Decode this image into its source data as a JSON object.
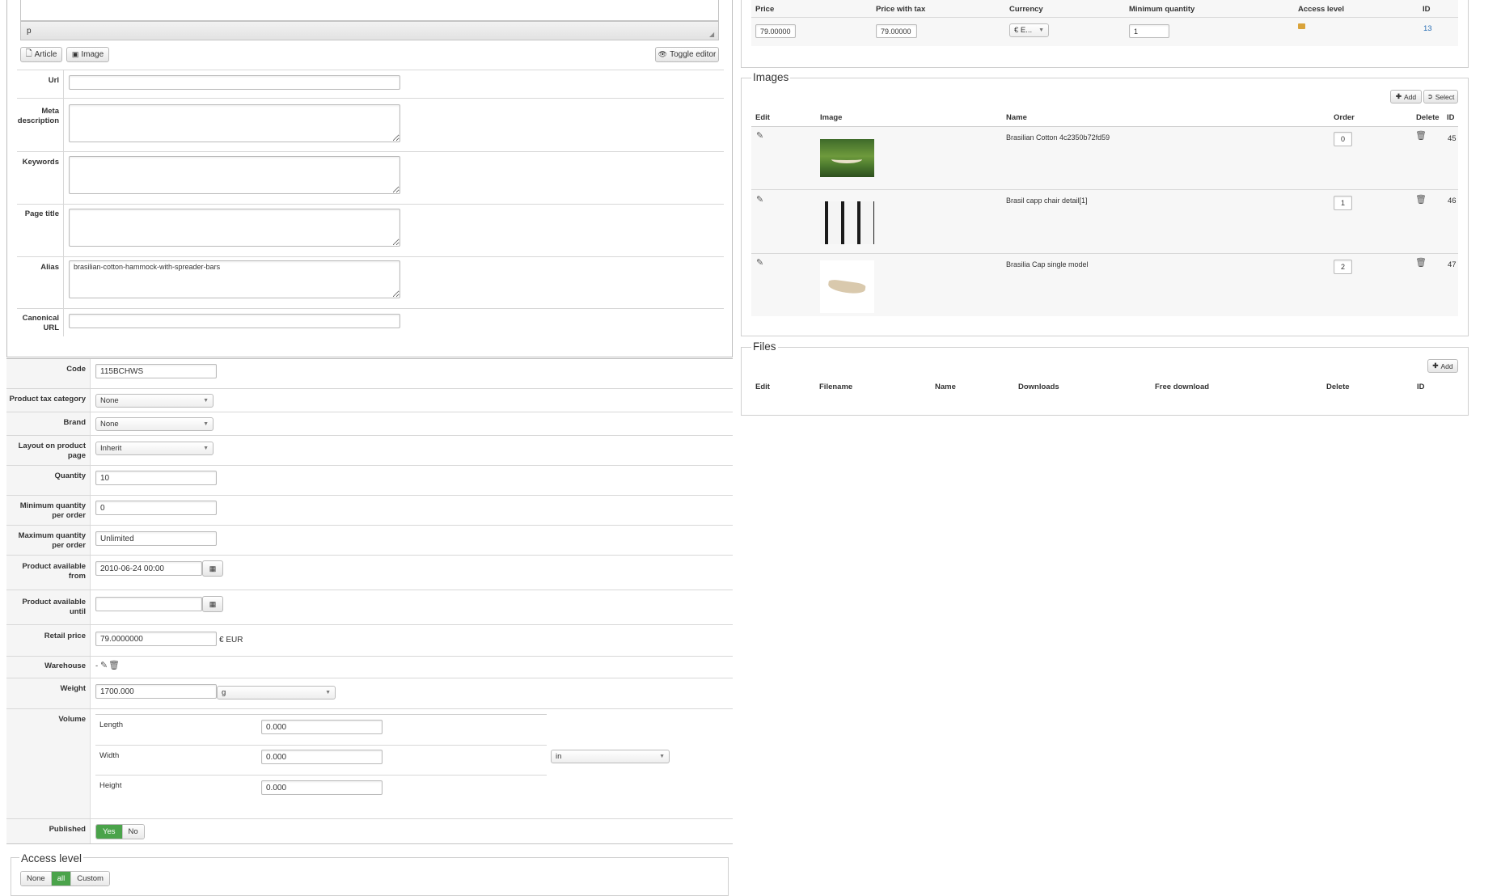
{
  "editor": {
    "status_path": "p",
    "article_button": "Article",
    "image_button": "Image",
    "toggle_editor_button": "Toggle editor"
  },
  "seo": {
    "url_label": "Url",
    "url_value": "",
    "meta_description_label": "Meta description",
    "meta_description_value": "",
    "keywords_label": "Keywords",
    "keywords_value": "",
    "page_title_label": "Page title",
    "page_title_value": "",
    "alias_label": "Alias",
    "alias_value": "brasilian-cotton-hammock-with-spreader-bars",
    "canonical_label": "Canonical URL",
    "canonical_value": ""
  },
  "product": {
    "code_label": "Code",
    "code_value": "115BCHWS",
    "tax_category_label": "Product tax category",
    "tax_category_value": "None",
    "brand_label": "Brand",
    "brand_value": "None",
    "layout_label": "Layout on product page",
    "layout_value": "Inherit",
    "quantity_label": "Quantity",
    "quantity_value": "10",
    "min_qty_label": "Minimum quantity per order",
    "min_qty_value": "0",
    "max_qty_label": "Maximum quantity per order",
    "max_qty_value": "Unlimited",
    "available_from_label": "Product available from",
    "available_from_value": "2010-06-24 00:00",
    "available_until_label": "Product available until",
    "available_until_value": "",
    "retail_price_label": "Retail price",
    "retail_price_value": "79.0000000",
    "retail_price_currency": "€ EUR",
    "warehouse_label": "Warehouse",
    "warehouse_value": "-",
    "weight_label": "Weight",
    "weight_value": "1700.000",
    "weight_unit": "g",
    "volume_label": "Volume",
    "length_label": "Length",
    "length_value": "0.000",
    "width_label": "Width",
    "width_value": "0.000",
    "height_label": "Height",
    "height_value": "0.000",
    "volume_unit": "in",
    "published_label": "Published",
    "published_yes": "Yes",
    "published_no": "No"
  },
  "access": {
    "legend": "Access level",
    "none": "None",
    "all": "all",
    "custom": "Custom"
  },
  "prices": {
    "headers": [
      "Price",
      "Price with tax",
      "Currency",
      "Minimum quantity",
      "Access level",
      "ID"
    ],
    "row": {
      "price": "79.00000",
      "price_with_tax": "79.00000",
      "currency": "€ E...",
      "min_qty": "1",
      "id": "13"
    }
  },
  "images": {
    "legend": "Images",
    "add_button": "Add",
    "select_button": "Select",
    "headers": [
      "Edit",
      "Image",
      "Name",
      "Order",
      "Delete",
      "ID"
    ],
    "rows": [
      {
        "name": "Brasilian Cotton 4c2350b72fd59",
        "order": "0",
        "id": "45"
      },
      {
        "name": "Brasil capp chair detail[1]",
        "order": "1",
        "id": "46"
      },
      {
        "name": "Brasilia Cap single model",
        "order": "2",
        "id": "47"
      }
    ]
  },
  "files": {
    "legend": "Files",
    "add_button": "Add",
    "headers": [
      "Edit",
      "Filename",
      "Name",
      "Downloads",
      "Free download",
      "Delete",
      "ID"
    ]
  }
}
